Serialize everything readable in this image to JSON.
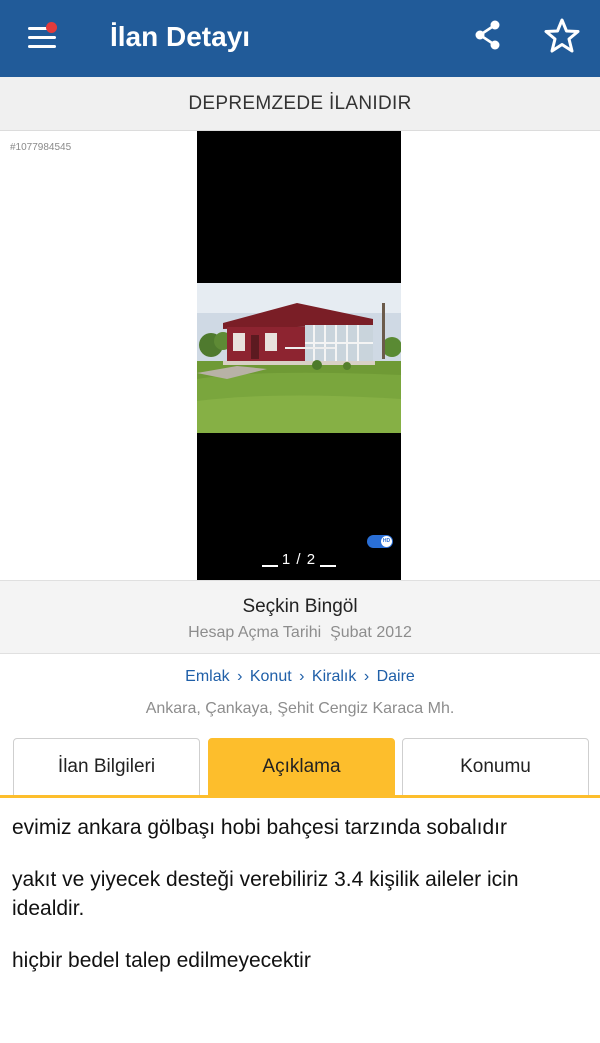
{
  "header": {
    "title": "İlan Detayı",
    "icons": {
      "menu": "menu-icon",
      "share": "share-icon",
      "favorite": "star-outline-icon"
    },
    "accent_color": "#215b99",
    "notification_dot_color": "#e33b3b"
  },
  "banner": {
    "text": "DEPREMZEDE İLANIDIR"
  },
  "listing": {
    "id_label": "#1077984545"
  },
  "gallery": {
    "page_current": "1",
    "page_separator": "/",
    "page_total": "2",
    "hd_toggle_label": "HD"
  },
  "seller": {
    "name": "Seçkin Bingöl",
    "since_label": "Hesap Açma Tarihi",
    "since_value": "Şubat 2012"
  },
  "breadcrumb": {
    "items": [
      "Emlak",
      "Konut",
      "Kiralık",
      "Daire"
    ],
    "separator": "›"
  },
  "location": {
    "text": "Ankara, Çankaya, Şehit Cengiz Karaca Mh."
  },
  "tabs": {
    "items": [
      "İlan Bilgileri",
      "Açıklama",
      "Konumu"
    ],
    "active": "Açıklama",
    "active_color": "#fdbe2c"
  },
  "description": {
    "paragraphs": [
      "evimiz ankara gölbaşı hobi bahçesi tarzında sobalıdır",
      "yakıt ve yiyecek desteği verebiliriz 3.4 kişilik aileler icin idealdir.",
      "hiçbir bedel talep edilmeyecektir"
    ]
  }
}
